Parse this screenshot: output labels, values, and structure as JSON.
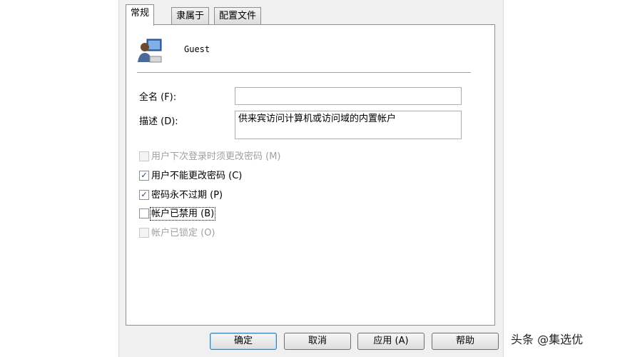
{
  "tabs": [
    {
      "label": "常规",
      "active": true
    },
    {
      "label": "隶属于",
      "active": false
    },
    {
      "label": "配置文件",
      "active": false
    }
  ],
  "user": {
    "name": "Guest",
    "icon": "user-icon"
  },
  "fields": {
    "full_name": {
      "label": "全名 (F):",
      "value": ""
    },
    "description": {
      "label": "描述 (D):",
      "value": "供来宾访问计算机或访问域的内置帐户"
    }
  },
  "checkboxes": [
    {
      "label": "用户下次登录时须更改密码 (M)",
      "checked": false,
      "enabled": false
    },
    {
      "label": "用户不能更改密码 (C)",
      "checked": true,
      "enabled": true
    },
    {
      "label": "密码永不过期 (P)",
      "checked": true,
      "enabled": true
    },
    {
      "label": "帐户已禁用 (B)",
      "checked": false,
      "enabled": true
    },
    {
      "label": "帐户已锁定 (O)",
      "checked": false,
      "enabled": false
    }
  ],
  "buttons": {
    "ok": "确定",
    "cancel": "取消",
    "apply": "应用 (A)",
    "help": "帮助"
  },
  "watermark": "头条 @集选优"
}
